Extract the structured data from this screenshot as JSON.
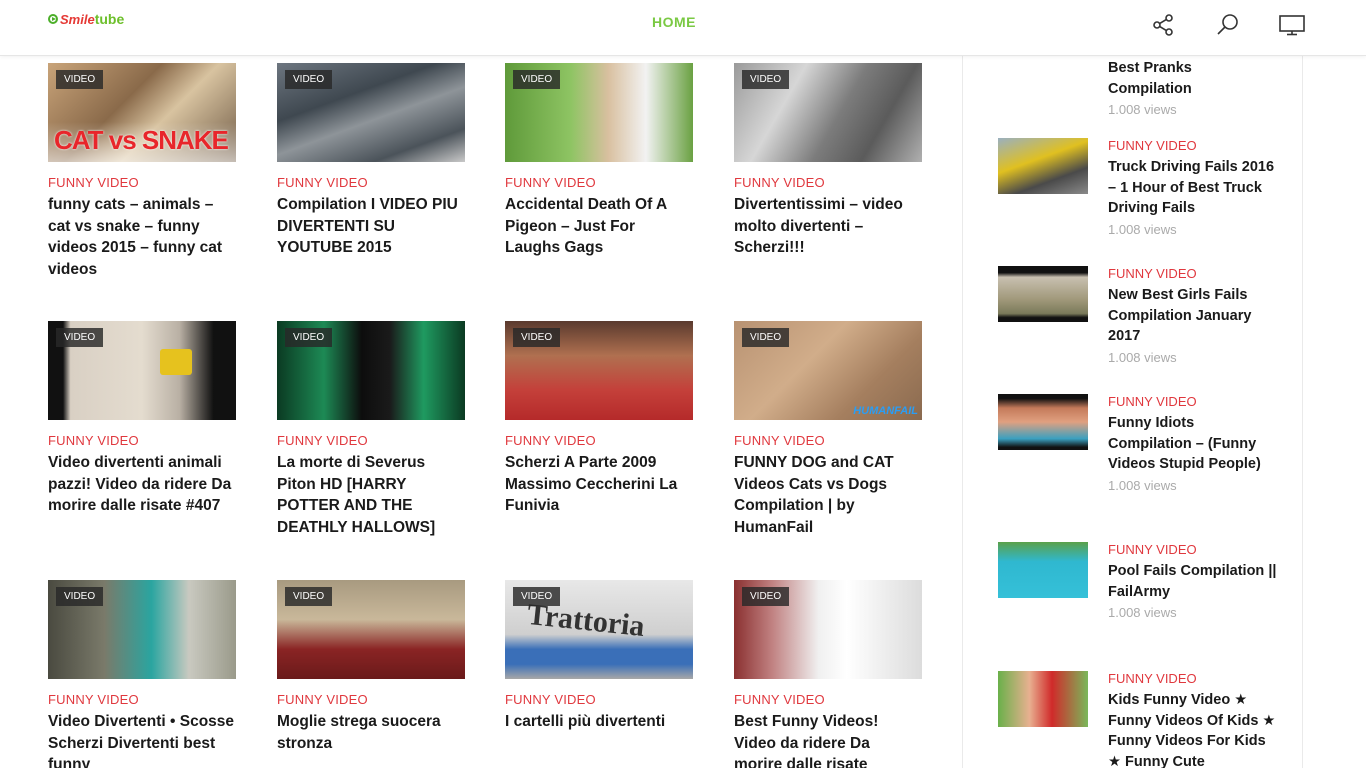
{
  "header": {
    "logo_smile": "Smile",
    "logo_tube": "tube",
    "nav_home": "HOME",
    "icons": [
      "share-icon",
      "search-icon",
      "monitor-icon"
    ],
    "accent": "#7ac943"
  },
  "grid": {
    "badge": "VIDEO",
    "category_color": "#e0383e",
    "cards": [
      {
        "category": "FUNNY VIDEO",
        "title": "funny cats – animals – cat vs snake – funny videos 2015 – funny cat videos",
        "thumb_text": "CAT vs SNAKE"
      },
      {
        "category": "FUNNY VIDEO",
        "title": "Compilation I VIDEO PIU DIVERTENTI SU YOUTUBE 2015",
        "thumb_text": ""
      },
      {
        "category": "FUNNY VIDEO",
        "title": "Accidental Death Of A Pigeon – Just For Laughs Gags",
        "thumb_text": ""
      },
      {
        "category": "FUNNY VIDEO",
        "title": "Divertentissimi – video molto divertenti – Scherzi!!!",
        "thumb_text": ""
      },
      {
        "category": "FUNNY VIDEO",
        "title": "Video divertenti animali pazzi! Video da ridere Da morire dalle risate #407",
        "thumb_text": ""
      },
      {
        "category": "FUNNY VIDEO",
        "title": "La morte di Severus Piton HD [HARRY POTTER AND THE DEATHLY HALLOWS]",
        "thumb_text": ""
      },
      {
        "category": "FUNNY VIDEO",
        "title": "Scherzi A Parte 2009 Massimo Ceccherini La Funivia",
        "thumb_text": ""
      },
      {
        "category": "FUNNY VIDEO",
        "title": "FUNNY DOG and CAT Videos Cats vs Dogs Compilation | by HumanFail",
        "thumb_text": "HUMANFAIL"
      },
      {
        "category": "FUNNY VIDEO",
        "title": "Video Divertenti • Scosse Scherzi Divertenti best funny",
        "thumb_text": ""
      },
      {
        "category": "FUNNY VIDEO",
        "title": "Moglie strega suocera stronza",
        "thumb_text": ""
      },
      {
        "category": "FUNNY VIDEO",
        "title": "I cartelli più divertenti",
        "thumb_text": "Trattoria"
      },
      {
        "category": "FUNNY VIDEO",
        "title": "Best Funny Videos! Video da ridere Da morire dalle risate",
        "thumb_text": ""
      }
    ]
  },
  "sidebar": {
    "top_item": {
      "title": "Best Pranks Compilation",
      "views": "1.008 views"
    },
    "items": [
      {
        "category": "FUNNY VIDEO",
        "title": "Truck Driving Fails 2016 – 1 Hour of Best Truck Driving Fails",
        "views": "1.008 views"
      },
      {
        "category": "FUNNY VIDEO",
        "title": "New Best Girls Fails Compilation January 2017",
        "views": "1.008 views"
      },
      {
        "category": "FUNNY VIDEO",
        "title": "Funny Idiots Compilation – (Funny Videos Stupid People)",
        "views": "1.008 views"
      },
      {
        "category": "FUNNY VIDEO",
        "title": "Pool Fails Compilation || FailArmy",
        "views": "1.008 views"
      },
      {
        "category": "FUNNY VIDEO",
        "title": "Kids Funny Video ★ Funny Videos Of Kids ★ Funny Videos For Kids ★ Funny Cute",
        "views": ""
      }
    ]
  }
}
